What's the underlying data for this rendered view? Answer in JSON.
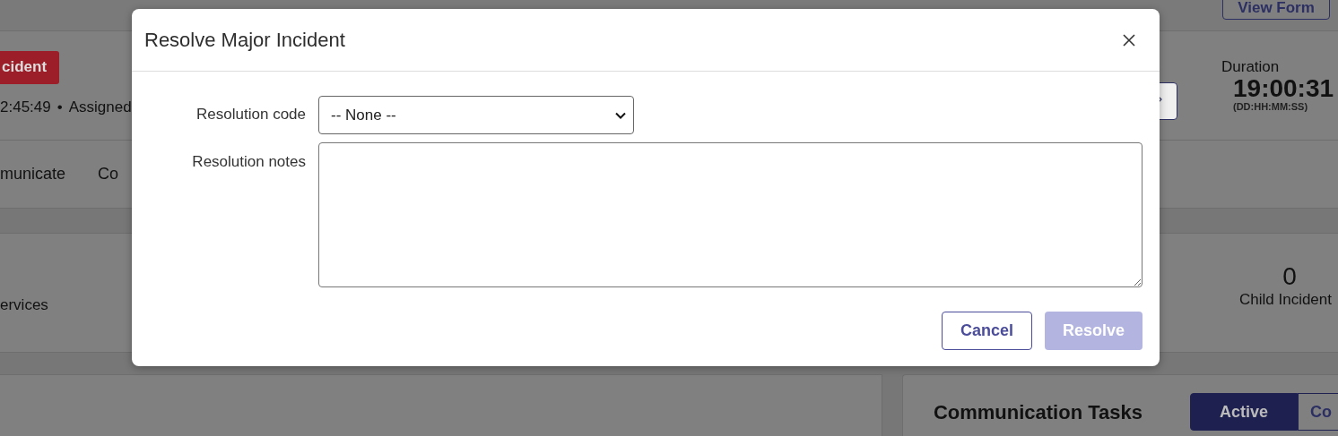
{
  "background": {
    "view_form_button": "View Form",
    "badge": "cident",
    "meta": [
      "2:45:49",
      "•",
      "Assigned"
    ],
    "tabs": [
      {
        "label": "municate"
      },
      {
        "label": "Co"
      }
    ],
    "duration": {
      "label": "Duration",
      "value": "19:00:31",
      "unit": "(DD:HH:MM:SS)"
    },
    "stats": [
      {
        "label": "ervices"
      },
      {
        "value": "0",
        "label": "Child Incident"
      }
    ],
    "communication_tasks": {
      "title": "Communication Tasks",
      "toggle": [
        {
          "label": "Active",
          "selected": true
        },
        {
          "label": "Co",
          "selected": false
        }
      ]
    }
  },
  "dialog": {
    "title": "Resolve Major Incident",
    "fields": [
      {
        "kind": "select",
        "label": "Resolution code",
        "value": "-- None --"
      },
      {
        "kind": "textarea",
        "label": "Resolution notes"
      }
    ],
    "buttons": [
      {
        "label": "Cancel",
        "kind": "secondary",
        "disabled": false
      },
      {
        "label": "Resolve",
        "kind": "primary",
        "disabled": true
      }
    ]
  }
}
